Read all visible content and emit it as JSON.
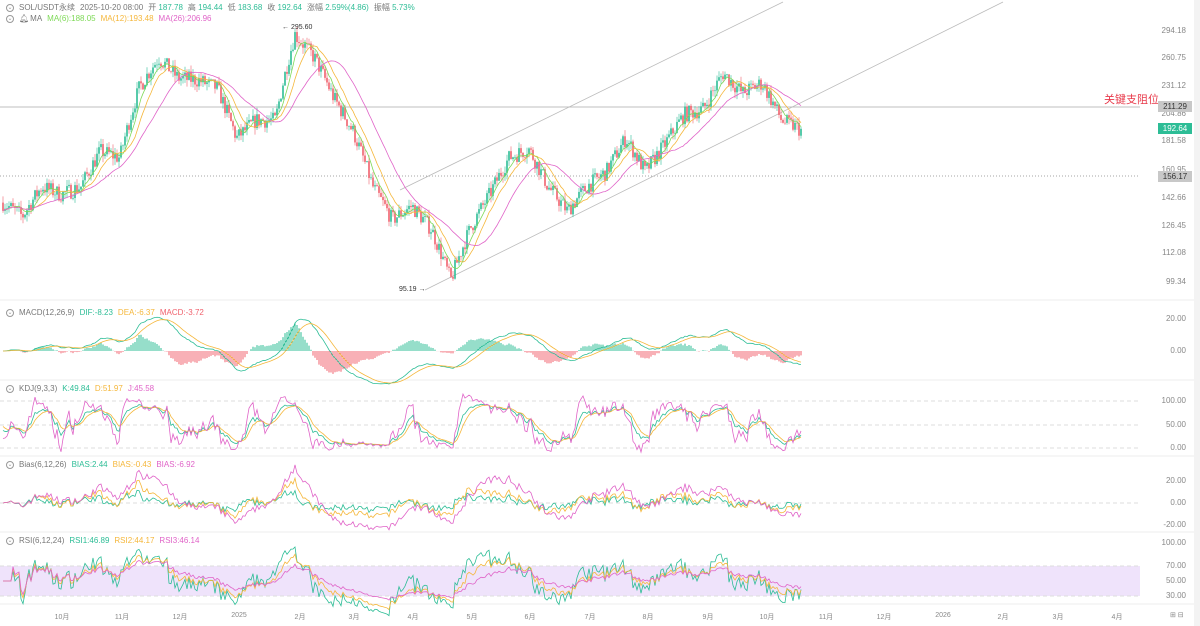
{
  "header": {
    "symbol": "SOL/USDT永续",
    "datetime": "2025-10-20 08:00",
    "open_label": "开",
    "open": "187.78",
    "high_label": "高",
    "high": "194.44",
    "low_label": "低",
    "low": "183.68",
    "close_label": "收",
    "close": "192.64",
    "change_label": "涨幅",
    "change": "2.59%(4.86)",
    "amp_label": "振幅",
    "amp": "5.73%"
  },
  "ma": {
    "label": "MA",
    "ma6": "MA(6):188.05",
    "ma12": "MA(12):193.48",
    "ma26": "MA(26):206.96"
  },
  "price_axis": [
    "294.18",
    "260.75",
    "231.12",
    "204.86",
    "181.58",
    "160.95",
    "142.66",
    "126.45",
    "112.08",
    "99.34"
  ],
  "price_tags": {
    "resistance": "211.29",
    "current": "192.64",
    "support": "156.17"
  },
  "annotation": "关键支阻位",
  "markers": {
    "high": "295.60",
    "low": "95.19"
  },
  "macd": {
    "label": "MACD(12,26,9)",
    "dif": "DIF:-8.23",
    "dea": "DEA:-6.37",
    "macd": "MACD:-3.72",
    "axis": [
      "20.00",
      "0.00"
    ]
  },
  "kdj": {
    "label": "KDJ(9,3,3)",
    "k": "K:49.84",
    "d": "D:51.97",
    "j": "J:45.58",
    "axis": [
      "100.00",
      "50.00",
      "0.00"
    ]
  },
  "bias": {
    "label": "Bias(6,12,26)",
    "b1": "BIAS:2.44",
    "b2": "BIAS:-0.43",
    "b3": "BIAS:-6.92",
    "axis": [
      "20.00",
      "0.00",
      "-20.00"
    ]
  },
  "rsi": {
    "label": "RSI(6,12,24)",
    "r1": "RSI1:46.89",
    "r2": "RSI2:44.17",
    "r3": "RSI3:46.14",
    "axis": [
      "100.00",
      "70.00",
      "50.00",
      "30.00"
    ]
  },
  "time_axis": [
    "10月",
    "11月",
    "12月",
    "2025",
    "2月",
    "3月",
    "4月",
    "5月",
    "6月",
    "7月",
    "8月",
    "9月",
    "10月",
    "11月",
    "12月",
    "2026",
    "2月",
    "3月",
    "4月"
  ],
  "colors": {
    "up": "#2dbd96",
    "down": "#f0616d",
    "ma6": "#7ed957",
    "ma12": "#f5b73b",
    "ma26": "#e064c8",
    "annotation": "#e8394a"
  },
  "price_path": [
    140,
    132,
    150,
    145,
    150,
    175,
    170,
    230,
    262,
    240,
    238,
    230,
    185,
    200,
    200,
    290,
    262,
    220,
    190,
    150,
    130,
    138,
    125,
    100,
    125,
    145,
    170,
    177,
    150,
    135,
    150,
    160,
    185,
    160,
    180,
    205,
    210,
    245,
    225,
    235,
    200,
    192
  ]
}
